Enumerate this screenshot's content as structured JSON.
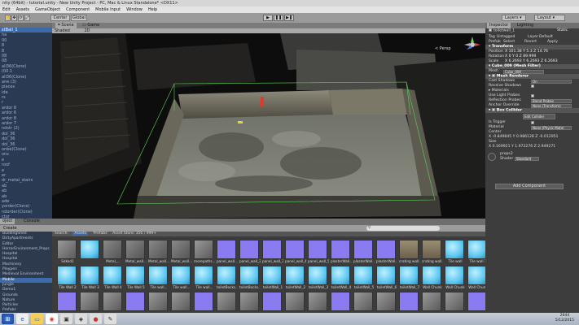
{
  "window": {
    "title": "nity (64bit) - tutorial.unity - New Unity Project - PC, Mac & Linux Standalone* <DX11>"
  },
  "menu": [
    "Edit",
    "Assets",
    "GameObject",
    "Component",
    "Mobile Input",
    "Window",
    "Help"
  ],
  "toolbar": {
    "center_label": "Center",
    "global_label": "Global",
    "layers_label": "Layers",
    "layout_label": "Layout",
    "play_icon": "▶",
    "pause_icon": "❚❚",
    "step_icon": "▶❚"
  },
  "hierarchy": {
    "items": [
      "stBall_1",
      "ha",
      "00",
      "8",
      "8",
      "08",
      "08",
      "all36(Clone)",
      "(00.1",
      "all36(Clone)",
      "ane (3)",
      "pieces",
      "ide",
      "rs",
      "r",
      "ardor 8",
      "ardor 6",
      "ardor 8",
      "ardor 7",
      "ndstr (2)",
      "dol_36",
      "dol_36",
      "dol_36",
      "onbe(Clone)",
      "ons",
      "e",
      "roof",
      "e",
      "er",
      "dr_metal_stairs",
      "ab",
      "ab",
      "ab",
      "ade",
      "yorder(Clone)",
      "ndorder(Clone)",
      "ctor",
      "ab",
      "it"
    ]
  },
  "scene": {
    "tabs": [
      "Scene",
      "Game"
    ],
    "shading": "Shaded",
    "two_d": "2D",
    "persp_label": "< Persp"
  },
  "inspector": {
    "tabs": [
      "Inspector",
      "Lighting"
    ],
    "object_name": "toiletwall_1",
    "static_label": "Static",
    "tag_label": "Tag",
    "tag_value": "Untagged",
    "layer_label": "Layer",
    "layer_value": "Default",
    "prefab_label": "Prefab",
    "select_label": "Select",
    "revert_label": "Revert",
    "apply_label": "Apply",
    "transform": {
      "title": "Transform",
      "position": "X 101.38  Y 5.3  Z 14.76",
      "rotation": "X 0  Y 0  Z 89.999",
      "scale": "X 6.2693  Y 6.2693  Z 6.2693"
    },
    "mesh_filter": {
      "title": "Cube_009 (Mesh Filter)",
      "mesh_label": "Mesh",
      "mesh_value": "Cube_009"
    },
    "mesh_renderer": {
      "title": "Mesh Renderer",
      "cast_shadows": "Cast Shadows",
      "cast_shadows_value": "On",
      "receive_shadows": "Receive Shadows",
      "materials": "Materials",
      "use_light_probes": "Use Light Probes",
      "reflection_probes": "Reflection Probes",
      "reflection_probes_value": "Blend Probes",
      "anchor_override": "Anchor Override",
      "anchor_override_value": "None (Transform)"
    },
    "box_collider": {
      "title": "Box Collider",
      "edit_collider": "Edit Collider",
      "is_trigger": "Is Trigger",
      "material": "Material",
      "material_value": "None (Physic Mater",
      "center": "Center",
      "center_value": "X -0.849845  Y 0.986128  Z -0.012951",
      "size": "Size",
      "size_value": "X 0.169921  Y 1.972276  Z 2.949271"
    },
    "material_name": "props2",
    "shader_label": "Shader",
    "shader_value": "Standard",
    "add_component": "Add Component"
  },
  "bottom": {
    "tabs": [
      "oject",
      "Console"
    ],
    "create_label": "Create",
    "search_label": "Search:",
    "search_filters": [
      "Assets",
      "'Prefabs'",
      "Asset Store: 356 / 999+"
    ],
    "breadcrumb": "",
    "tree": [
      "BuildingShed",
      "DirtyApartments",
      "Editor",
      "HorrorEnvironment_Props",
      "Hospital",
      "Hospital",
      "Machinery",
      "Playpen",
      "Medieval Environment",
      "Mobile",
      "Jungle",
      "Demo1",
      "Grounds",
      "Nature",
      "Particles",
      "Prefabs"
    ],
    "assets_row1": [
      "Sdkkd1",
      "",
      "Metal_...",
      "Metal_wall...",
      "Metal_wall...",
      "Metal_wall...",
      "morepaths...",
      "panel_wall...",
      "panel_wall_2",
      "panel_wall_3",
      "panel_wall_4",
      "panel_wall_5",
      "plasterWall...",
      "plasterWall...",
      "plasterWall...",
      "crating wall...",
      "crating wall...",
      "Tile wall",
      "Tile wall 1",
      "Tile wall 2"
    ],
    "assets_row2": [
      "Tile Wall 2",
      "Tile Wall 3",
      "Tile Wall 4",
      "Tile Wall 5",
      "Tile wall...",
      "Tile wall...",
      "Tile wall...",
      "toiletBocks...",
      "toiletBocks...",
      "toiletWall_1",
      "toiletWall_2",
      "toiletWall_3",
      "toiletWall_4",
      "toiletWall_5",
      "toiletWall_6",
      "toiletWall_7",
      "Wall Chunk",
      "Wall Chunk",
      "Wall Chunk"
    ]
  },
  "taskbar": {
    "time": "2644",
    "date": "5/12/2015"
  },
  "colors": {
    "selection": "#3d6aa8",
    "cube_blue": "#5ec8f0",
    "normal_map": "#8a7cf0"
  }
}
